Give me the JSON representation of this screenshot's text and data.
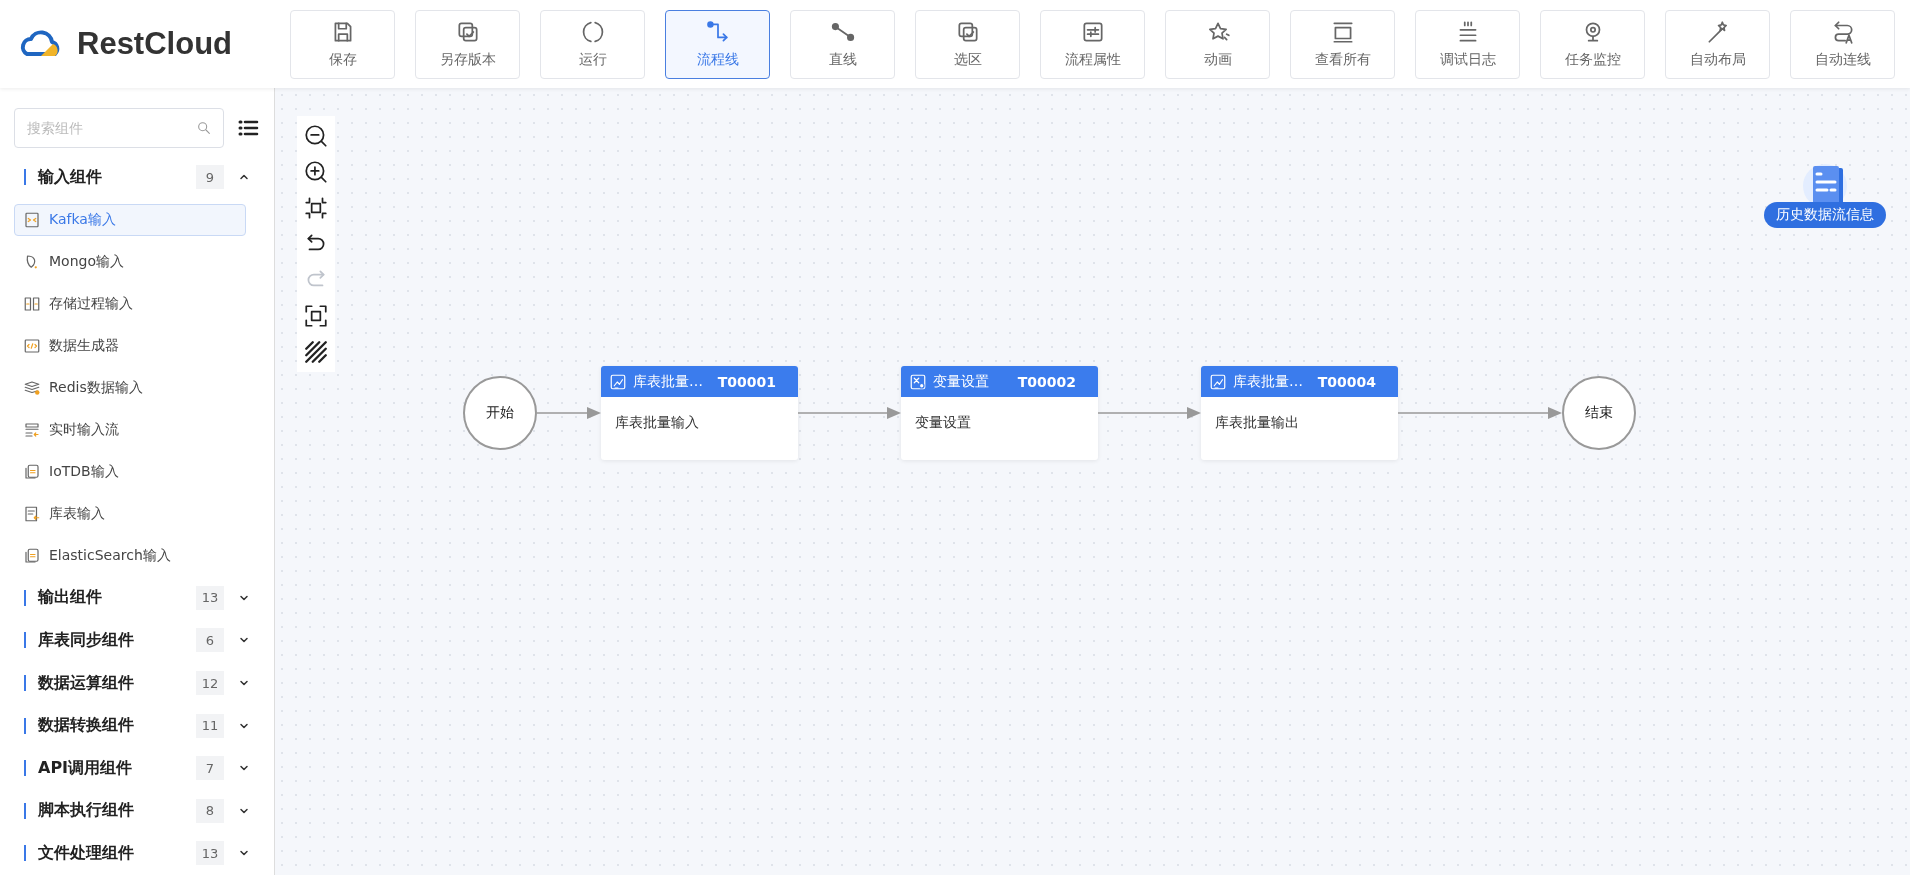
{
  "logo": {
    "text": "RestCloud"
  },
  "toolbar": [
    {
      "label": "保存",
      "selected": false
    },
    {
      "label": "另存版本",
      "selected": false
    },
    {
      "label": "运行",
      "selected": false
    },
    {
      "label": "流程线",
      "selected": true
    },
    {
      "label": "直线",
      "selected": false
    },
    {
      "label": "选区",
      "selected": false
    },
    {
      "label": "流程属性",
      "selected": false
    },
    {
      "label": "动画",
      "selected": false
    },
    {
      "label": "查看所有",
      "selected": false
    },
    {
      "label": "调试日志",
      "selected": false
    },
    {
      "label": "任务监控",
      "selected": false
    },
    {
      "label": "自动布局",
      "selected": false
    },
    {
      "label": "自动连线",
      "selected": false
    }
  ],
  "sidebar": {
    "search": {
      "placeholder": "搜索组件"
    },
    "groups": [
      {
        "label": "输入组件",
        "count": "9",
        "expanded": true,
        "items": [
          {
            "label": "Kafka输入",
            "selected": true
          },
          {
            "label": "Mongo输入",
            "selected": false
          },
          {
            "label": "存储过程输入",
            "selected": false
          },
          {
            "label": "数据生成器",
            "selected": false
          },
          {
            "label": "Redis数据输入",
            "selected": false
          },
          {
            "label": "实时输入流",
            "selected": false
          },
          {
            "label": "IoTDB输入",
            "selected": false
          },
          {
            "label": "库表输入",
            "selected": false
          },
          {
            "label": "ElasticSearch输入",
            "selected": false
          }
        ]
      },
      {
        "label": "输出组件",
        "count": "13",
        "expanded": false
      },
      {
        "label": "库表同步组件",
        "count": "6",
        "expanded": false
      },
      {
        "label": "数据运算组件",
        "count": "12",
        "expanded": false
      },
      {
        "label": "数据转换组件",
        "count": "11",
        "expanded": false
      },
      {
        "label": "API调用组件",
        "count": "7",
        "expanded": false
      },
      {
        "label": "脚本执行组件",
        "count": "8",
        "expanded": false
      },
      {
        "label": "文件处理组件",
        "count": "13",
        "expanded": false
      }
    ]
  },
  "canvas_tools": [
    {
      "disabled": false
    },
    {
      "disabled": false
    },
    {
      "disabled": false
    },
    {
      "disabled": false
    },
    {
      "disabled": true
    },
    {
      "disabled": false
    },
    {
      "disabled": false
    }
  ],
  "flow": {
    "start": {
      "label": "开始"
    },
    "nodes": [
      {
        "kind": "input",
        "title": "库表批量…",
        "id": "T00001",
        "body": "库表批量输入"
      },
      {
        "kind": "setting",
        "title": "变量设置",
        "id": "T00002",
        "body": "变量设置"
      },
      {
        "kind": "output",
        "title": "库表批量…",
        "id": "T00004",
        "body": "库表批量输出"
      }
    ],
    "end": {
      "label": "结束"
    }
  },
  "history_badge": {
    "label": "历史数据流信息"
  }
}
